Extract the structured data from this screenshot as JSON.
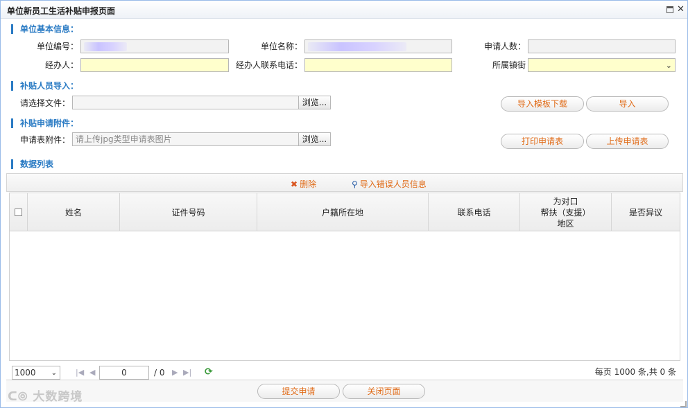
{
  "window": {
    "title": "单位新员工生活补贴申报页面"
  },
  "sections": {
    "basic_info": "单位基本信息：",
    "import_people": "补贴人员导入：",
    "attachment": "补贴申请附件：",
    "data_list": "数据列表"
  },
  "form": {
    "unit_code_label": "单位编号：",
    "unit_code_value": "",
    "unit_name_label": "单位名称：",
    "unit_name_value": "",
    "applicant_count_label": "申请人数：",
    "applicant_count_value": "",
    "handler_label": "经办人：",
    "handler_value": "",
    "handler_phone_label": "经办人联系电话：",
    "handler_phone_value": "",
    "street_label": "所属镇街",
    "street_value": "",
    "select_file_label": "请选择文件：",
    "select_file_value": "",
    "attachment_label": "申请表附件：",
    "attachment_placeholder": "请上传jpg类型申请表图片",
    "browse_label": "浏览..."
  },
  "buttons": {
    "download_template": "导入模板下载",
    "import": "导入",
    "print_form": "打印申请表",
    "upload_form": "上传申请表",
    "submit": "提交申请",
    "close_page": "关闭页面"
  },
  "grid_toolbar": {
    "delete": "删除",
    "import_error": "导入错误人员信息"
  },
  "table": {
    "columns": [
      "姓名",
      "证件号码",
      "户籍所在地",
      "联系电话",
      "为对口\n帮扶（支援）\n地区",
      "是否异议"
    ],
    "rows": []
  },
  "pager": {
    "page_size": "1000",
    "current_page": "0",
    "total_pages": "/ 0",
    "info": "每页 1000 条,共 0 条"
  },
  "watermark": "大数跨境",
  "colors": {
    "section_accent": "#2a7bc4",
    "button_text": "#e06a16",
    "yellow_field": "#ffffcc"
  },
  "icons": {
    "delete": "cross-icon",
    "import_error": "search-icon",
    "refresh": "refresh-icon"
  }
}
